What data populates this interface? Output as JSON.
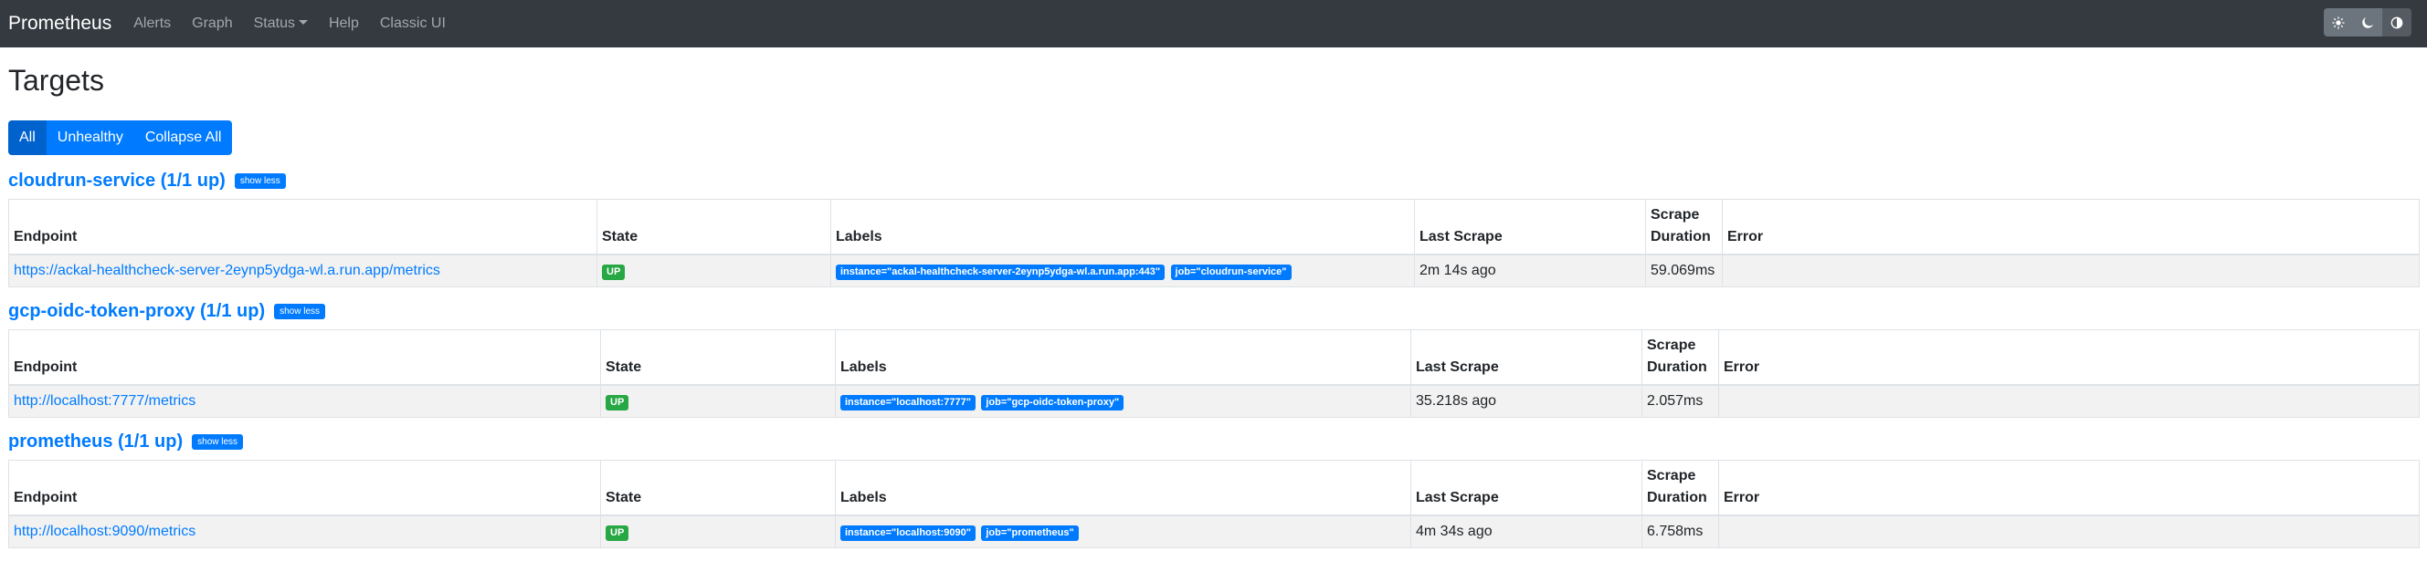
{
  "nav": {
    "brand": "Prometheus",
    "links": [
      "Alerts",
      "Graph",
      "Status",
      "Help",
      "Classic UI"
    ]
  },
  "theme": {
    "light_icon": "sun-icon",
    "dark_icon": "moon-icon",
    "auto_icon": "half-circle-icon"
  },
  "page": {
    "title": "Targets"
  },
  "filters": {
    "all": "All",
    "unhealthy": "Unhealthy",
    "collapse": "Collapse All"
  },
  "table_headers": {
    "endpoint": "Endpoint",
    "state": "State",
    "labels": "Labels",
    "last_scrape": "Last Scrape",
    "scrape_duration_line1": "Scrape",
    "scrape_duration_line2": "Duration",
    "error": "Error"
  },
  "pools": [
    {
      "title": "cloudrun-service (1/1 up)",
      "toggle": "show less",
      "target": {
        "endpoint": "https://ackal-healthcheck-server-2eynp5ydga-wl.a.run.app/metrics",
        "state": "UP",
        "labels": [
          "instance=\"ackal-healthcheck-server-2eynp5ydga-wl.a.run.app:443\"",
          "job=\"cloudrun-service\""
        ],
        "last_scrape": "2m 14s ago",
        "duration": "59.069ms",
        "error": ""
      }
    },
    {
      "title": "gcp-oidc-token-proxy (1/1 up)",
      "toggle": "show less",
      "target": {
        "endpoint": "http://localhost:7777/metrics",
        "state": "UP",
        "labels": [
          "instance=\"localhost:7777\"",
          "job=\"gcp-oidc-token-proxy\""
        ],
        "last_scrape": "35.218s ago",
        "duration": "2.057ms",
        "error": ""
      }
    },
    {
      "title": "prometheus (1/1 up)",
      "toggle": "show less",
      "target": {
        "endpoint": "http://localhost:9090/metrics",
        "state": "UP",
        "labels": [
          "instance=\"localhost:9090\"",
          "job=\"prometheus\""
        ],
        "last_scrape": "4m 34s ago",
        "duration": "6.758ms",
        "error": ""
      }
    }
  ],
  "colors": {
    "navbar": "#343a40",
    "primary": "#007bff",
    "success": "#28a745"
  }
}
